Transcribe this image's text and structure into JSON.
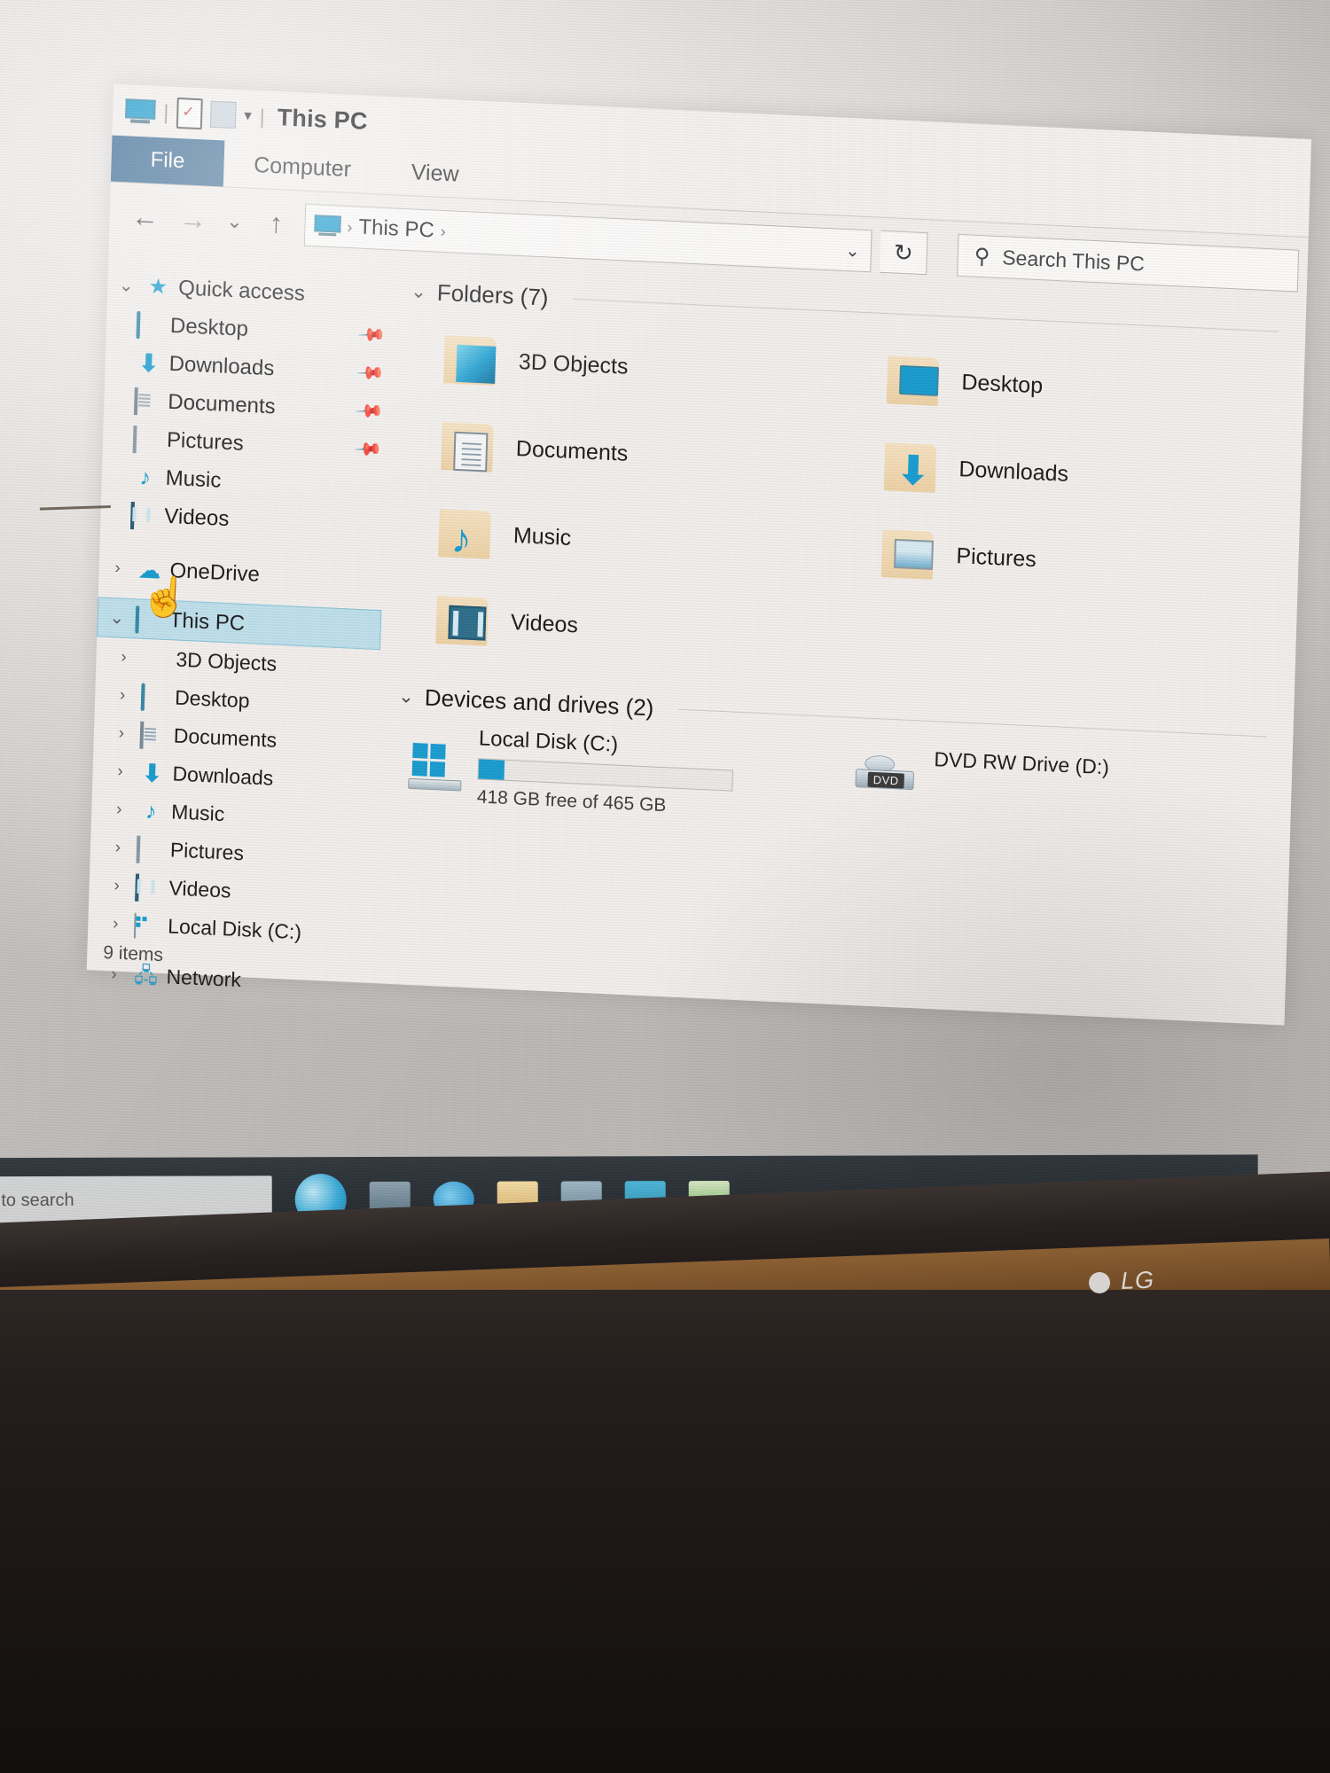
{
  "window": {
    "title": "This PC",
    "quick_access_toolbar": [
      {
        "icon": "this-pc-icon",
        "name": "This PC"
      },
      {
        "icon": "properties-icon",
        "name": "Properties"
      },
      {
        "icon": "new-folder-icon",
        "name": "New folder"
      },
      {
        "icon": "customize-chevron-icon",
        "name": "Customize Quick Access Toolbar"
      }
    ]
  },
  "ribbon": {
    "tabs": [
      {
        "label": "File",
        "active": true
      },
      {
        "label": "Computer",
        "active": false
      },
      {
        "label": "View",
        "active": false
      }
    ]
  },
  "navbar": {
    "back": "←",
    "forward": "→",
    "recent_chevron": "⌄",
    "up": "↑",
    "breadcrumb": {
      "icon": "this-pc-icon",
      "sep1": "›",
      "item": "This PC",
      "sep2": "›"
    },
    "address_chevron": "⌄",
    "refresh": "↻",
    "search": {
      "icon": "⚲",
      "placeholder": "Search This PC",
      "value": ""
    }
  },
  "sidebar": {
    "groups": [
      {
        "label": "Quick access",
        "icon": "star-pin-icon",
        "expander": "⌄",
        "expanded": true,
        "items": [
          {
            "label": "Desktop",
            "icon": "desktop-icon",
            "pinned": true,
            "pin": "📌"
          },
          {
            "label": "Downloads",
            "icon": "downloads-icon",
            "pinned": true,
            "pin": "📌"
          },
          {
            "label": "Documents",
            "icon": "documents-icon",
            "pinned": true,
            "pin": "📌"
          },
          {
            "label": "Pictures",
            "icon": "pictures-icon",
            "pinned": true,
            "pin": "📌"
          },
          {
            "label": "Music",
            "icon": "music-icon",
            "pinned": false,
            "pin": ""
          },
          {
            "label": "Videos",
            "icon": "videos-icon",
            "pinned": false,
            "pin": ""
          }
        ]
      },
      {
        "label": "OneDrive",
        "icon": "cloud-icon",
        "expander": "›",
        "expanded": false,
        "items": []
      },
      {
        "label": "This PC",
        "icon": "this-pc-icon",
        "expander": "⌄",
        "expanded": true,
        "selected": true,
        "items": [
          {
            "label": "3D Objects",
            "icon": "3d-objects-icon",
            "expander": "›"
          },
          {
            "label": "Desktop",
            "icon": "desktop-icon",
            "expander": "›"
          },
          {
            "label": "Documents",
            "icon": "documents-icon",
            "expander": "›"
          },
          {
            "label": "Downloads",
            "icon": "downloads-icon",
            "expander": "›"
          },
          {
            "label": "Music",
            "icon": "music-icon",
            "expander": "›"
          },
          {
            "label": "Pictures",
            "icon": "pictures-icon",
            "expander": "›"
          },
          {
            "label": "Videos",
            "icon": "videos-icon",
            "expander": "›"
          },
          {
            "label": "Local Disk (C:)",
            "icon": "disk-icon",
            "expander": "›"
          }
        ]
      },
      {
        "label": "Network",
        "icon": "network-icon",
        "expander": "›",
        "expanded": false,
        "items": []
      }
    ]
  },
  "content": {
    "folders_group": {
      "chevron": "⌄",
      "label": "Folders (7)",
      "items": [
        {
          "label": "3D Objects",
          "icon": "3d-objects-folder-icon"
        },
        {
          "label": "Desktop",
          "icon": "desktop-folder-icon"
        },
        {
          "label": "Documents",
          "icon": "documents-folder-icon"
        },
        {
          "label": "Downloads",
          "icon": "downloads-folder-icon"
        },
        {
          "label": "Music",
          "icon": "music-folder-icon"
        },
        {
          "label": "Pictures",
          "icon": "pictures-folder-icon"
        },
        {
          "label": "Videos",
          "icon": "videos-folder-icon"
        }
      ]
    },
    "devices_group": {
      "chevron": "⌄",
      "label": "Devices and drives (2)",
      "drives": [
        {
          "name": "Local Disk (C:)",
          "icon": "windows-drive-icon",
          "capacity_text": "418 GB free of 465 GB",
          "free_gb": 418,
          "total_gb": 465,
          "used_percent": 10,
          "bar_color": "#1b9dd0"
        },
        {
          "name": "DVD RW Drive (D:)",
          "icon": "dvd-drive-icon",
          "badge": "DVD",
          "capacity_text": ""
        }
      ]
    }
  },
  "statusbar": {
    "item_count": "9 items"
  },
  "cursor": {
    "type": "hand-pointer",
    "glyph": "☝"
  },
  "taskbar": {
    "search_icon": "⚲",
    "search_placeholder": "Type here to search",
    "cortana": "cortana-icon",
    "pinned": [
      {
        "name": "task-view-icon"
      },
      {
        "name": "edge-browser-icon"
      },
      {
        "name": "file-explorer-icon"
      },
      {
        "name": "store-icon"
      },
      {
        "name": "mail-icon"
      },
      {
        "name": "whatsapp-icon"
      }
    ]
  },
  "monitor": {
    "brand": "LG"
  },
  "colors": {
    "accent_blue": "#1b9dd0",
    "file_tab_blue": "#3f6e96",
    "selection_blue": "#bfe0ec",
    "window_bg": "#f2efed",
    "folder_tan": "#eed2a6"
  }
}
